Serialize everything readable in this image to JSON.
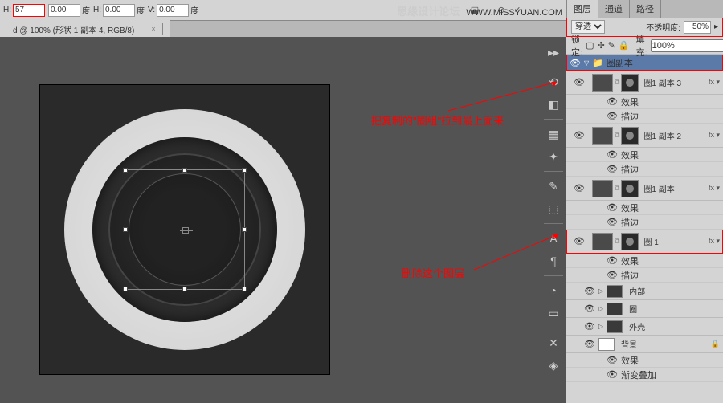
{
  "watermark": {
    "site": "思缘设计论坛",
    "url": "WWW.MISSYUAN.COM"
  },
  "toolbar": {
    "fields": [
      {
        "label": "H:",
        "value": "57",
        "hl": true
      },
      {
        "label": "",
        "value": "0.00",
        "unit": "度"
      },
      {
        "label": "H:",
        "value": "0.00",
        "unit": "度"
      },
      {
        "label": "V:",
        "value": "0.00",
        "unit": "度"
      }
    ]
  },
  "doctab": {
    "title": "d @ 100% (形状 1 副本 4, RGB/8)"
  },
  "panel": {
    "tabs": [
      "图层",
      "通道",
      "路径"
    ],
    "blend": "穿透",
    "opacity_label": "不透明度:",
    "opacity": "50%",
    "lock_label": "锁定:",
    "fill_label": "填充:",
    "fill": "100%",
    "group": "圈副本",
    "layers": [
      {
        "name": "圈1 副本 3",
        "fx": true
      },
      {
        "name": "圈1 副本 2",
        "fx": true
      },
      {
        "name": "圈1 副本",
        "fx": true
      },
      {
        "name": "圈 1",
        "fx": true,
        "sel": true
      }
    ],
    "sub_fx": "效果",
    "sub_stroke": "描边",
    "simple": [
      {
        "name": "内部",
        "icon": "folder"
      },
      {
        "name": "圈",
        "icon": "folder"
      },
      {
        "name": "外壳",
        "icon": "folder"
      },
      {
        "name": "背景",
        "icon": "white",
        "lock": true
      }
    ],
    "bg_fx": "效果",
    "bg_grad": "渐变叠加"
  },
  "annotations": {
    "a1": "把复制的\"圈组\"拉到最上面来",
    "a2": "删除这个图层"
  }
}
